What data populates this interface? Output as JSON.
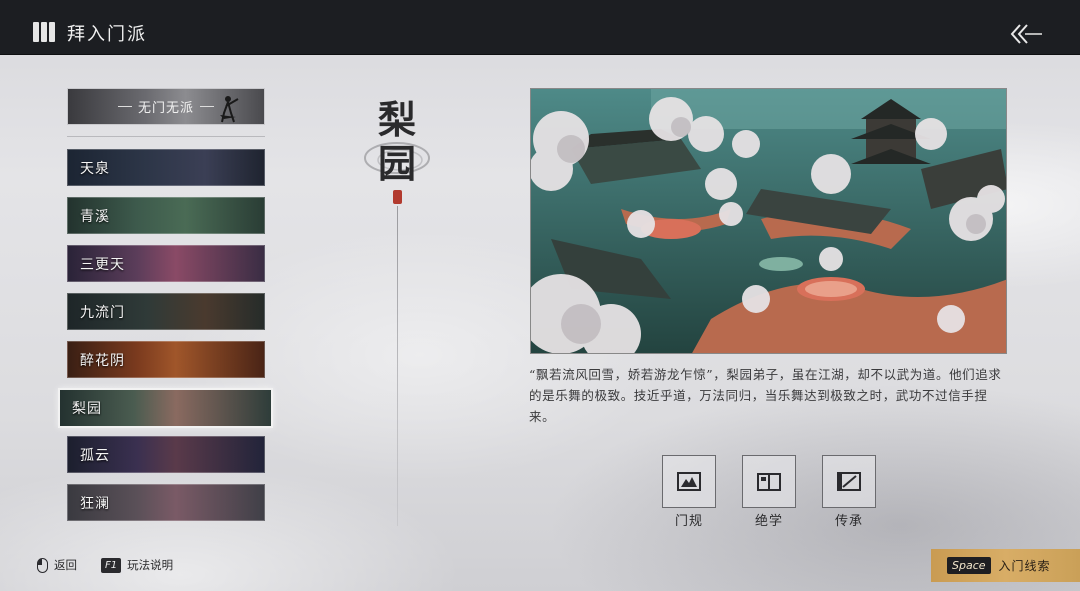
{
  "header": {
    "title": "拜入门派",
    "menu_icon": "book-icon",
    "back_icon": "double-chevron-back-icon"
  },
  "sidebar": {
    "head_label": "无门无派",
    "items": [
      {
        "label": "天泉"
      },
      {
        "label": "青溪"
      },
      {
        "label": "三更天"
      },
      {
        "label": "九流门"
      },
      {
        "label": "醉花阴"
      },
      {
        "label": "梨园",
        "selected": true
      },
      {
        "label": "孤云"
      },
      {
        "label": "狂澜"
      }
    ]
  },
  "detail": {
    "name_char_1": "梨",
    "name_char_2": "园",
    "description": "“飘若流风回雪，娇若游龙乍惊”，梨园弟子，虽在江湖，却不以武为道。他们追求的是乐舞的极致。技近乎道，万法同归，当乐舞达到极致之时，武功不过信手捏来。",
    "actions": [
      {
        "label": "门规",
        "icon": "scroll-rules-icon"
      },
      {
        "label": "绝学",
        "icon": "open-book-icon"
      },
      {
        "label": "传承",
        "icon": "inheritance-icon"
      }
    ]
  },
  "footer": {
    "back_label": "返回",
    "help_key": "F1",
    "help_label": "玩法说明",
    "space_key": "Space",
    "space_label": "入门线索"
  },
  "colors": {
    "topbar": "#1c1e22",
    "seal": "#b23a2e",
    "space_bar": "#d8ad66"
  }
}
